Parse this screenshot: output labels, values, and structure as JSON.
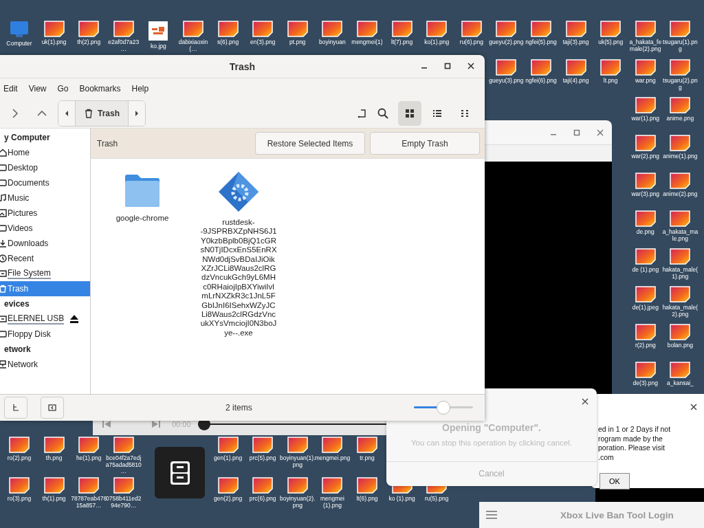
{
  "desktop": {
    "icons": [
      {
        "label": "Computer",
        "kind": "computer"
      },
      {
        "label": "uk(1).png",
        "kind": "image"
      },
      {
        "label": "th(2).png",
        "kind": "image"
      },
      {
        "label": "e2af0d7a23…",
        "kind": "image"
      },
      {
        "label": "ko.jpg",
        "kind": "photo"
      },
      {
        "label": "dabixiaoxin (…",
        "kind": "image"
      },
      {
        "label": "s(6).png",
        "kind": "image"
      },
      {
        "label": "en(3).png",
        "kind": "image"
      },
      {
        "label": "pt.png",
        "kind": "image"
      },
      {
        "label": "boyinyuan",
        "kind": "image"
      },
      {
        "label": "mengmei(1)",
        "kind": "image"
      },
      {
        "label": "lt(7).png",
        "kind": "image"
      },
      {
        "label": "ko(1).png",
        "kind": "image"
      },
      {
        "label": "ru(6).png",
        "kind": "image"
      },
      {
        "label": "gueyu(2).png",
        "kind": "image"
      },
      {
        "label": "ngfei(5).png",
        "kind": "image"
      },
      {
        "label": "taji(3).png",
        "kind": "image"
      },
      {
        "label": "uk(5).png",
        "kind": "image"
      },
      {
        "label": "a_hakata_female(2).png",
        "kind": "image"
      },
      {
        "label": "tsugaru(1).png",
        "kind": "image"
      },
      {
        "label": "gueyu(3).png",
        "kind": "image"
      },
      {
        "label": "ngfei(6).png",
        "kind": "image"
      },
      {
        "label": "taji(4).png",
        "kind": "image"
      },
      {
        "label": "lt.png",
        "kind": "image"
      },
      {
        "label": "war.png",
        "kind": "image"
      },
      {
        "label": "tsugaru(2).png",
        "kind": "image"
      },
      {
        "label": "war(1).png",
        "kind": "image"
      },
      {
        "label": "anime.png",
        "kind": "image"
      },
      {
        "label": "war(2).png",
        "kind": "image"
      },
      {
        "label": "anime(1).png",
        "kind": "image"
      },
      {
        "label": "war(3).png",
        "kind": "image"
      },
      {
        "label": "anime(2).png",
        "kind": "image"
      },
      {
        "label": "de.png",
        "kind": "image"
      },
      {
        "label": "a_hakata_male.png",
        "kind": "image"
      },
      {
        "label": "de (1).png",
        "kind": "image"
      },
      {
        "label": "hakata_male(1).png",
        "kind": "image"
      },
      {
        "label": "de(1).jpeg",
        "kind": "image"
      },
      {
        "label": "hakata_male(2).png",
        "kind": "image"
      },
      {
        "label": "r(2).png",
        "kind": "image"
      },
      {
        "label": "bolan.png",
        "kind": "image"
      },
      {
        "label": "de(3).png",
        "kind": "image"
      },
      {
        "label": "a_kansai_",
        "kind": "image"
      },
      {
        "label": "ro(2).png",
        "kind": "image"
      },
      {
        "label": "th.png",
        "kind": "image"
      },
      {
        "label": "he(1).png",
        "kind": "image"
      },
      {
        "label": "bce04f2a7edja75adad5810…",
        "kind": "image"
      },
      {
        "label": "gen(1).png",
        "kind": "image"
      },
      {
        "label": "prc(5).png",
        "kind": "image"
      },
      {
        "label": "boyinyuan(1).png",
        "kind": "image"
      },
      {
        "label": "mengmei.png",
        "kind": "image"
      },
      {
        "label": "tr.png",
        "kind": "image"
      },
      {
        "label": "ro(3).png",
        "kind": "image"
      },
      {
        "label": "th(1).png",
        "kind": "image"
      },
      {
        "label": "78787eab47615a857…",
        "kind": "image"
      },
      {
        "label": "0758b411ed294e790…",
        "kind": "image"
      },
      {
        "label": "gen(2).png",
        "kind": "image"
      },
      {
        "label": "prc(6).png",
        "kind": "image"
      },
      {
        "label": "boyinyuan(2).png",
        "kind": "image"
      },
      {
        "label": "mengmei (1).png",
        "kind": "image"
      },
      {
        "label": "lt(6).png",
        "kind": "image"
      },
      {
        "label": "ko (1).png",
        "kind": "image"
      },
      {
        "label": "ru(5).png",
        "kind": "image"
      }
    ]
  },
  "file_manager": {
    "title": "Trash",
    "menu": [
      "Edit",
      "View",
      "Go",
      "Bookmarks",
      "Help"
    ],
    "location": "Trash",
    "view_modes": [
      {
        "kind": "grid",
        "selected": true
      },
      {
        "kind": "list",
        "selected": false
      },
      {
        "kind": "compact",
        "selected": false
      }
    ],
    "sidebar": [
      {
        "heading": "y Computer",
        "items": [
          {
            "label": "Home",
            "kind": "home",
            "selected": false
          },
          {
            "label": "Desktop",
            "kind": "desktop",
            "selected": false
          },
          {
            "label": "Documents",
            "kind": "folder",
            "selected": false
          },
          {
            "label": "Music",
            "kind": "music",
            "selected": false
          },
          {
            "label": "Pictures",
            "kind": "pictures",
            "selected": false
          },
          {
            "label": "Videos",
            "kind": "videos",
            "selected": false
          },
          {
            "label": "Downloads",
            "kind": "download",
            "selected": false
          },
          {
            "label": "Recent",
            "kind": "recent",
            "selected": false
          },
          {
            "label": "File System",
            "kind": "drive",
            "selected": false
          },
          {
            "label": "Trash",
            "kind": "trash",
            "selected": true
          }
        ]
      },
      {
        "heading": "evices",
        "items": [
          {
            "label": "ELERNEL USB",
            "kind": "usb",
            "selected": false
          },
          {
            "label": "Floppy Disk",
            "kind": "floppy",
            "selected": false
          }
        ]
      },
      {
        "heading": "etwork",
        "items": [
          {
            "label": "Network",
            "kind": "network",
            "selected": false
          }
        ]
      }
    ],
    "header": {
      "label": "Trash",
      "buttons": [
        "Restore Selected Items",
        "Empty Trash"
      ]
    },
    "files": [
      {
        "name": "google-chrome",
        "kind": "folder"
      },
      {
        "name": "rustdesk--9JSPRBXZpNHS6J1Y0kzbBplb0BjQ1cGRsN0TjIDcxEnS5EnRXNWd0djSvBDaIJiOikXZrJCLi8Waus2clRGdzVncukGch9yL6MHc0RHaiojIpBXYiwiIvlmLrNXZkR3c1JnL5FGbIJnI6ISehxWZyJCLi8Waus2clRGdzVncukXYsVmciojI0N3boJye--.exe",
        "kind": "executable"
      }
    ],
    "status": "2 items",
    "zoom": {
      "level": 0.5
    }
  },
  "media_player": {
    "time": "00:00"
  },
  "progress_dialog": {
    "title": "Opening \"Computer\".",
    "message": "You can stop this operation by clicking cancel.",
    "button": "Cancel"
  },
  "notice_dialog": {
    "lines": [
      "ed in 1 or 2 Days if not",
      "rogram made by the",
      "poration. Please visit",
      ".com"
    ],
    "button": "OK"
  },
  "login_window": {
    "title": "Xbox Live Ban Tool Login"
  }
}
